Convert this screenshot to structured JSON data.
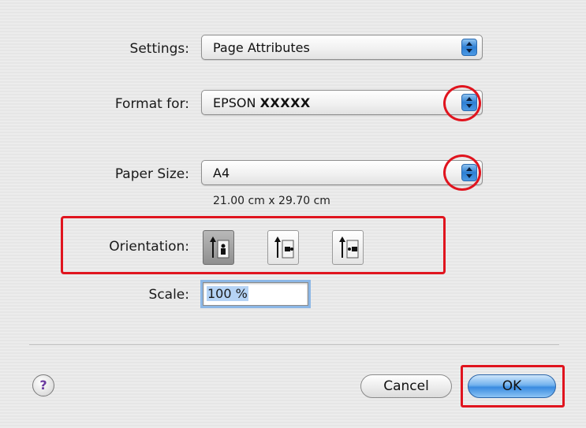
{
  "settings": {
    "label": "Settings:",
    "value": "Page Attributes"
  },
  "format_for": {
    "label": "Format for:",
    "value_prefix": "EPSON",
    "value_model": "XXXXX"
  },
  "paper_size": {
    "label": "Paper Size:",
    "value": "A4",
    "dimensions": "21.00 cm x 29.70 cm"
  },
  "orientation": {
    "label": "Orientation:",
    "options": [
      "portrait",
      "landscape-left",
      "landscape-right"
    ],
    "selected": "portrait"
  },
  "scale": {
    "label": "Scale:",
    "value": "100 %"
  },
  "buttons": {
    "help": "?",
    "cancel": "Cancel",
    "ok": "OK"
  },
  "colors": {
    "highlight_red": "#e0141e",
    "aqua_blue": "#3a8be0"
  },
  "icons": [
    "stepper-icon",
    "portrait-orientation-icon",
    "landscape-left-orientation-icon",
    "landscape-right-orientation-icon",
    "help-icon"
  ]
}
